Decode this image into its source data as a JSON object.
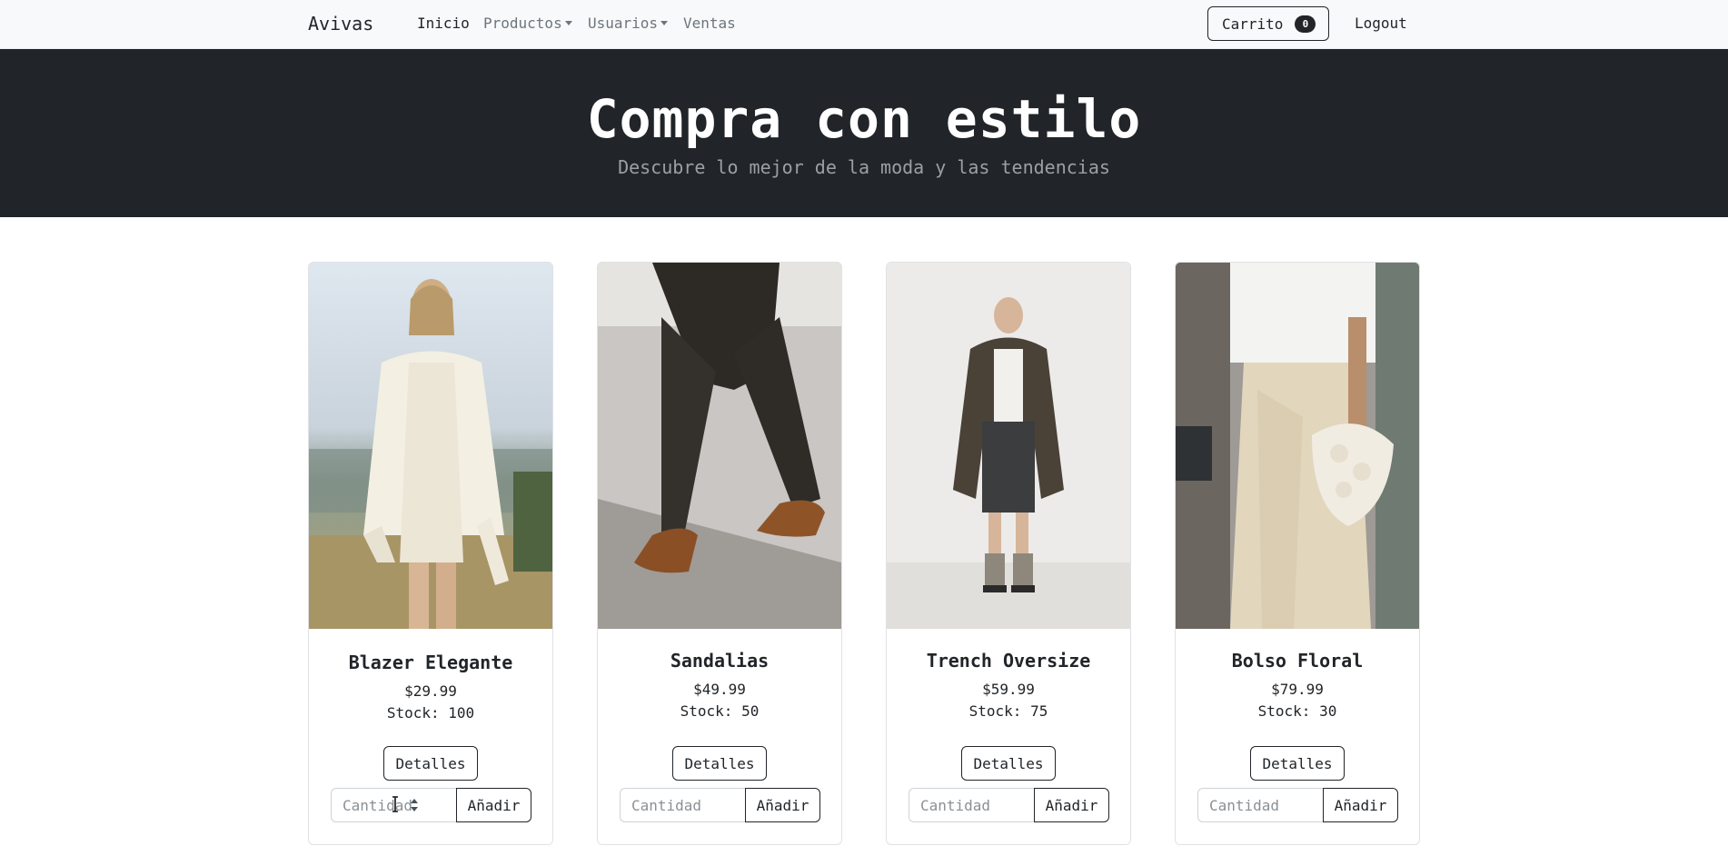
{
  "nav": {
    "brand": "Avivas",
    "links": [
      {
        "label": "Inicio"
      },
      {
        "label": "Productos"
      },
      {
        "label": "Usuarios"
      },
      {
        "label": "Ventas"
      }
    ],
    "cart_label": "Carrito",
    "cart_count": "0",
    "logout": "Logout"
  },
  "hero": {
    "title": "Compra con estilo",
    "subtitle": "Descubre lo mejor de la moda y las tendencias"
  },
  "products": [
    {
      "name": "Blazer Elegante",
      "price": "$29.99",
      "stock": "Stock: 100",
      "details": "Detalles",
      "qty_placeholder": "Cantidad",
      "add": "Añadir"
    },
    {
      "name": "Sandalias",
      "price": "$49.99",
      "stock": "Stock: 50",
      "details": "Detalles",
      "qty_placeholder": "Cantidad",
      "add": "Añadir"
    },
    {
      "name": "Trench Oversize",
      "price": "$59.99",
      "stock": "Stock: 75",
      "details": "Detalles",
      "qty_placeholder": "Cantidad",
      "add": "Añadir"
    },
    {
      "name": "Bolso Floral",
      "price": "$79.99",
      "stock": "Stock: 30",
      "details": "Detalles",
      "qty_placeholder": "Cantidad",
      "add": "Añadir"
    }
  ],
  "colors": {
    "navbar": "#f8f9fa",
    "hero": "#212529",
    "text": "#212529",
    "muted": "#6c757d"
  }
}
